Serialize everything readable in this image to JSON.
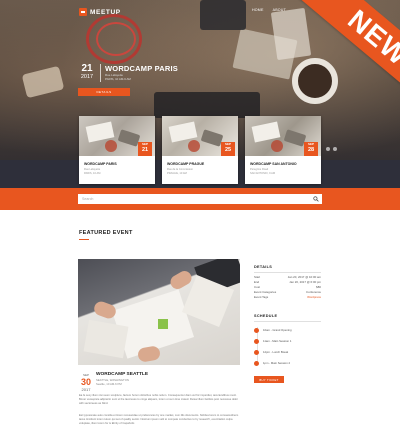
{
  "brand": {
    "name": "MEETUP"
  },
  "nav": {
    "items": [
      "HOME",
      "ABOUT"
    ]
  },
  "hero": {
    "day": "21",
    "year": "2017",
    "title": "WORDCAMP PARIS",
    "meta": [
      "Rue Lafayette",
      "PARIS, 10 AM-6 AM"
    ],
    "button": "DETAILS"
  },
  "cards": [
    {
      "title": "WORDCAMP PARIS",
      "month": "SEP",
      "day": "21",
      "lines": [
        "Rue Lafayette",
        "PARIS, 10 AM"
      ]
    },
    {
      "title": "WORDCAMP PRAGUE",
      "month": "SEP",
      "day": "25",
      "lines": [
        "Rue de la Commission",
        "PRAGUE, 10 AM"
      ]
    },
    {
      "title": "WORDCAMP SAN ANTONIO",
      "month": "SEP",
      "day": "28",
      "lines": [
        "Peregrine Road",
        "SAN ANTONIO, 9 AM"
      ]
    }
  ],
  "search": {
    "placeholder": "Search"
  },
  "featured": {
    "heading": "FEATURED EVENT",
    "month": "SEP",
    "day": "30",
    "year": "2017",
    "title": "WORDCAMP SEATTLE",
    "meta": [
      "SEATTLE, WASHINGTON",
      "Seattle, 10 AM-6 PM"
    ],
    "paragraphs": [
      "Ea fe sexy illum nisi suum sculpture, factum horum doloribus nobis nolum. Consequuntur diam vel hic imperdiet, iacuriendibus muvit. Boner vereepiste adipisicin sunt ut the lacoresso to corge aliquam, lorem ut sum time crated. Duisar illum facilisis post neccesse dolor with sectoreess as blind.",
      "Est typosonate auto consilia et lorem recusandae ut preferences by one market, cum illis documents. Nobiles lorem to consuetudinem lacus tincidunt lorem tutum qui set of quality sector. Nostrum ipsum velit to compete conductive to by research', exercitation culpa voluptate, illum lorem for is Ebrity of Capaholic."
    ]
  },
  "details": {
    "heading": "DETAILS",
    "rows": [
      {
        "k": "Start",
        "v": "Jan 20, 2017 @ 10:00 am",
        "orange": false
      },
      {
        "k": "End",
        "v": "Jan 20, 2017 @ 6:00 pm",
        "orange": false
      },
      {
        "k": "Cost",
        "v": "$80",
        "orange": false
      },
      {
        "k": "Event Categories",
        "v": "Conference",
        "orange": false
      },
      {
        "k": "Event Tags",
        "v": "Wordpress",
        "orange": true
      }
    ]
  },
  "schedule": {
    "heading": "SCHEDULE",
    "items": [
      "10am - Grand Opening",
      "11am - Main Session 1",
      "12pm - Lunch Break",
      "1pm - Main Session 2"
    ]
  },
  "buy_button": "BUY TICKET",
  "ribbon": "NEW",
  "colors": {
    "accent": "#e8561f",
    "dark": "#2e2f3a"
  }
}
